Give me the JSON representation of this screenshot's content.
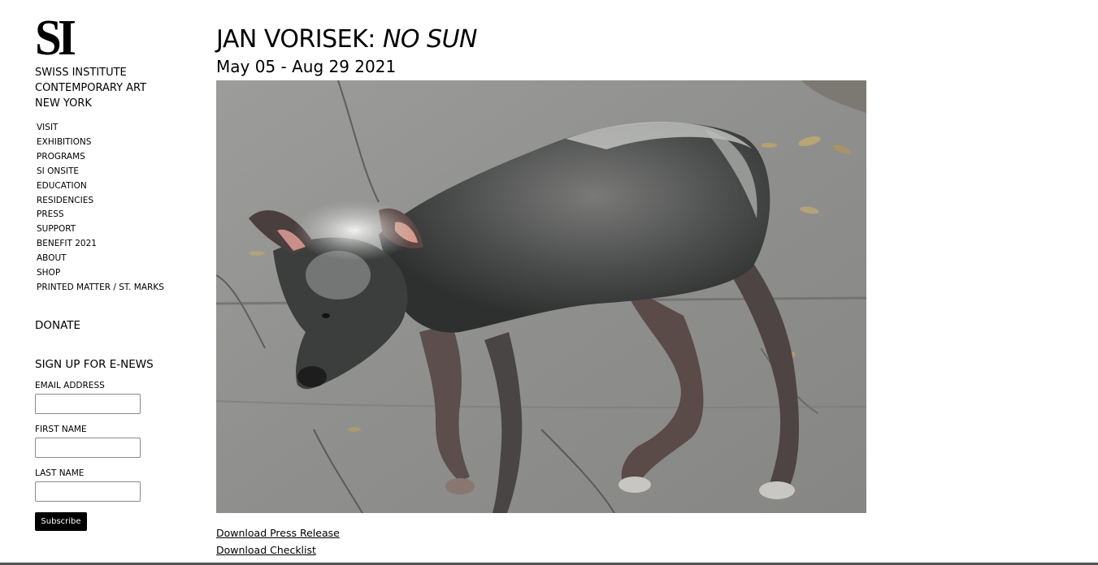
{
  "logo": {
    "text": "SI"
  },
  "institution": {
    "lines": [
      "SWISS INSTITUTE",
      "CONTEMPORARY ART",
      "NEW YORK"
    ]
  },
  "nav": {
    "items": [
      {
        "label": "VISIT"
      },
      {
        "label": "EXHIBITIONS"
      },
      {
        "label": "PROGRAMS"
      },
      {
        "label": "SI ONSITE"
      },
      {
        "label": "EDUCATION"
      },
      {
        "label": "RESIDENCIES"
      },
      {
        "label": "PRESS"
      },
      {
        "label": "SUPPORT"
      },
      {
        "label": "BENEFIT 2021"
      },
      {
        "label": "ABOUT"
      },
      {
        "label": "SHOP"
      },
      {
        "label": "PRINTED MATTER / ST. MARKS"
      }
    ]
  },
  "donate": {
    "label": "DONATE"
  },
  "enews": {
    "heading": "SIGN UP FOR E-NEWS",
    "fields": [
      {
        "label": "EMAIL ADDRESS",
        "value": "",
        "placeholder": ""
      },
      {
        "label": "FIRST NAME",
        "value": "",
        "placeholder": ""
      },
      {
        "label": "LAST NAME",
        "value": "",
        "placeholder": ""
      }
    ],
    "subscribe_label": "Subscribe"
  },
  "exhibition": {
    "artist": "JAN VORISEK:",
    "title": "NO SUN",
    "dates": "May 05 - Aug 29 2021"
  },
  "hero_image": {
    "subject": "hairless dog walking on pavement"
  },
  "downloads": {
    "press_release": "Download Press Release",
    "checklist": "Download Checklist"
  },
  "colors": {
    "text": "#000000",
    "background": "#ffffff",
    "button_bg": "#000000",
    "button_text": "#ffffff"
  }
}
